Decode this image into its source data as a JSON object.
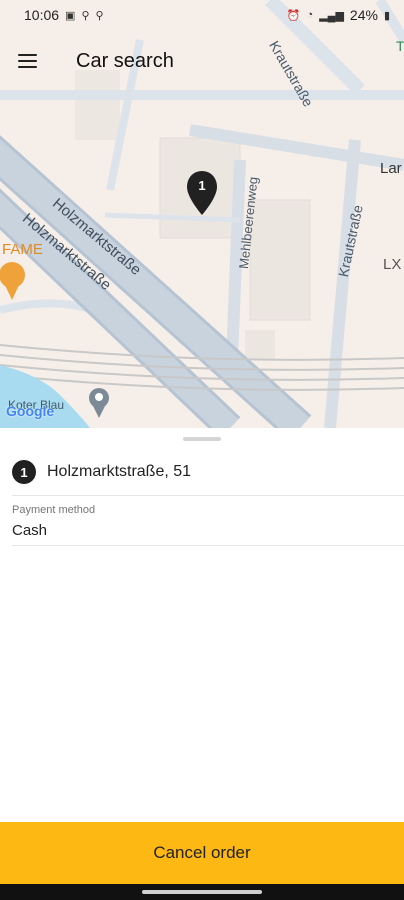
{
  "status_bar": {
    "time": "10:06",
    "battery": "24%",
    "left_icons": [
      "image-icon",
      "location-icon",
      "location-icon"
    ],
    "right_icons": [
      "alarm-icon",
      "wifi-icon",
      "signal-icon",
      "battery-icon"
    ]
  },
  "app_bar": {
    "title": "Car search",
    "menu_icon": "menu-icon"
  },
  "map": {
    "streets": [
      "Krautstraße",
      "Holzmarktstraße",
      "Holzmarktstraße",
      "Mehlbeerenweg",
      "Krautstraße"
    ],
    "poi": "FAME",
    "place": "Koter Blau",
    "edge_labels": [
      "Lar",
      "LX",
      "T"
    ],
    "logo": "Google",
    "marker_number": "1"
  },
  "sheet": {
    "address_number": "1",
    "address": "Holzmarktstraße, 51",
    "payment_label": "Payment method",
    "payment_value": "Cash"
  },
  "actions": {
    "cancel_label": "Cancel order"
  },
  "colors": {
    "accent": "#fdb813",
    "marker": "#212121"
  }
}
